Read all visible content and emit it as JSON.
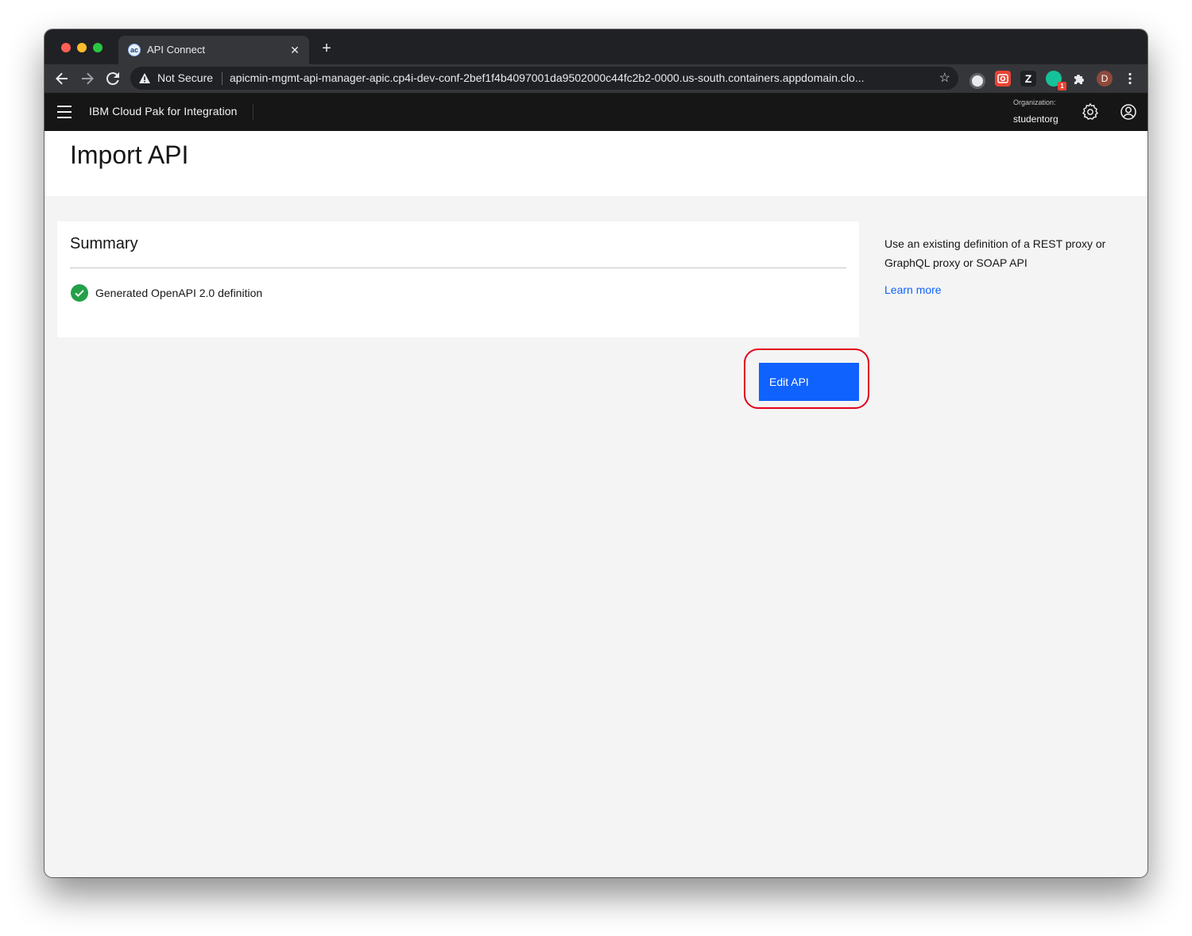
{
  "browser": {
    "tab_title": "API Connect",
    "tab_favicon_text": "ac",
    "new_tab_label": "+",
    "security_label": "Not Secure",
    "url": "apicmin-mgmt-api-manager-apic.cp4i-dev-conf-2bef1f4b4097001da9502000c44fc2b2-0000.us-south.containers.appdomain.clo...",
    "extension_badge": "1",
    "profile_initial": "D",
    "extension_z": "Z"
  },
  "header": {
    "brand": "IBM Cloud Pak for Integration",
    "org_label": "Organization:",
    "org_value": "studentorg"
  },
  "page": {
    "title": "Import API"
  },
  "summary": {
    "title": "Summary",
    "items": [
      {
        "label": "Generated OpenAPI 2.0 definition",
        "status": "success"
      }
    ]
  },
  "sidebar": {
    "help_text": "Use an existing definition of a REST proxy or GraphQL proxy or SOAP API",
    "learn_more": "Learn more"
  },
  "actions": {
    "edit_api": "Edit API"
  },
  "colors": {
    "primary": "#0f62fe",
    "success": "#24a148",
    "highlight": "#e3001b",
    "header_bg": "#161616"
  }
}
